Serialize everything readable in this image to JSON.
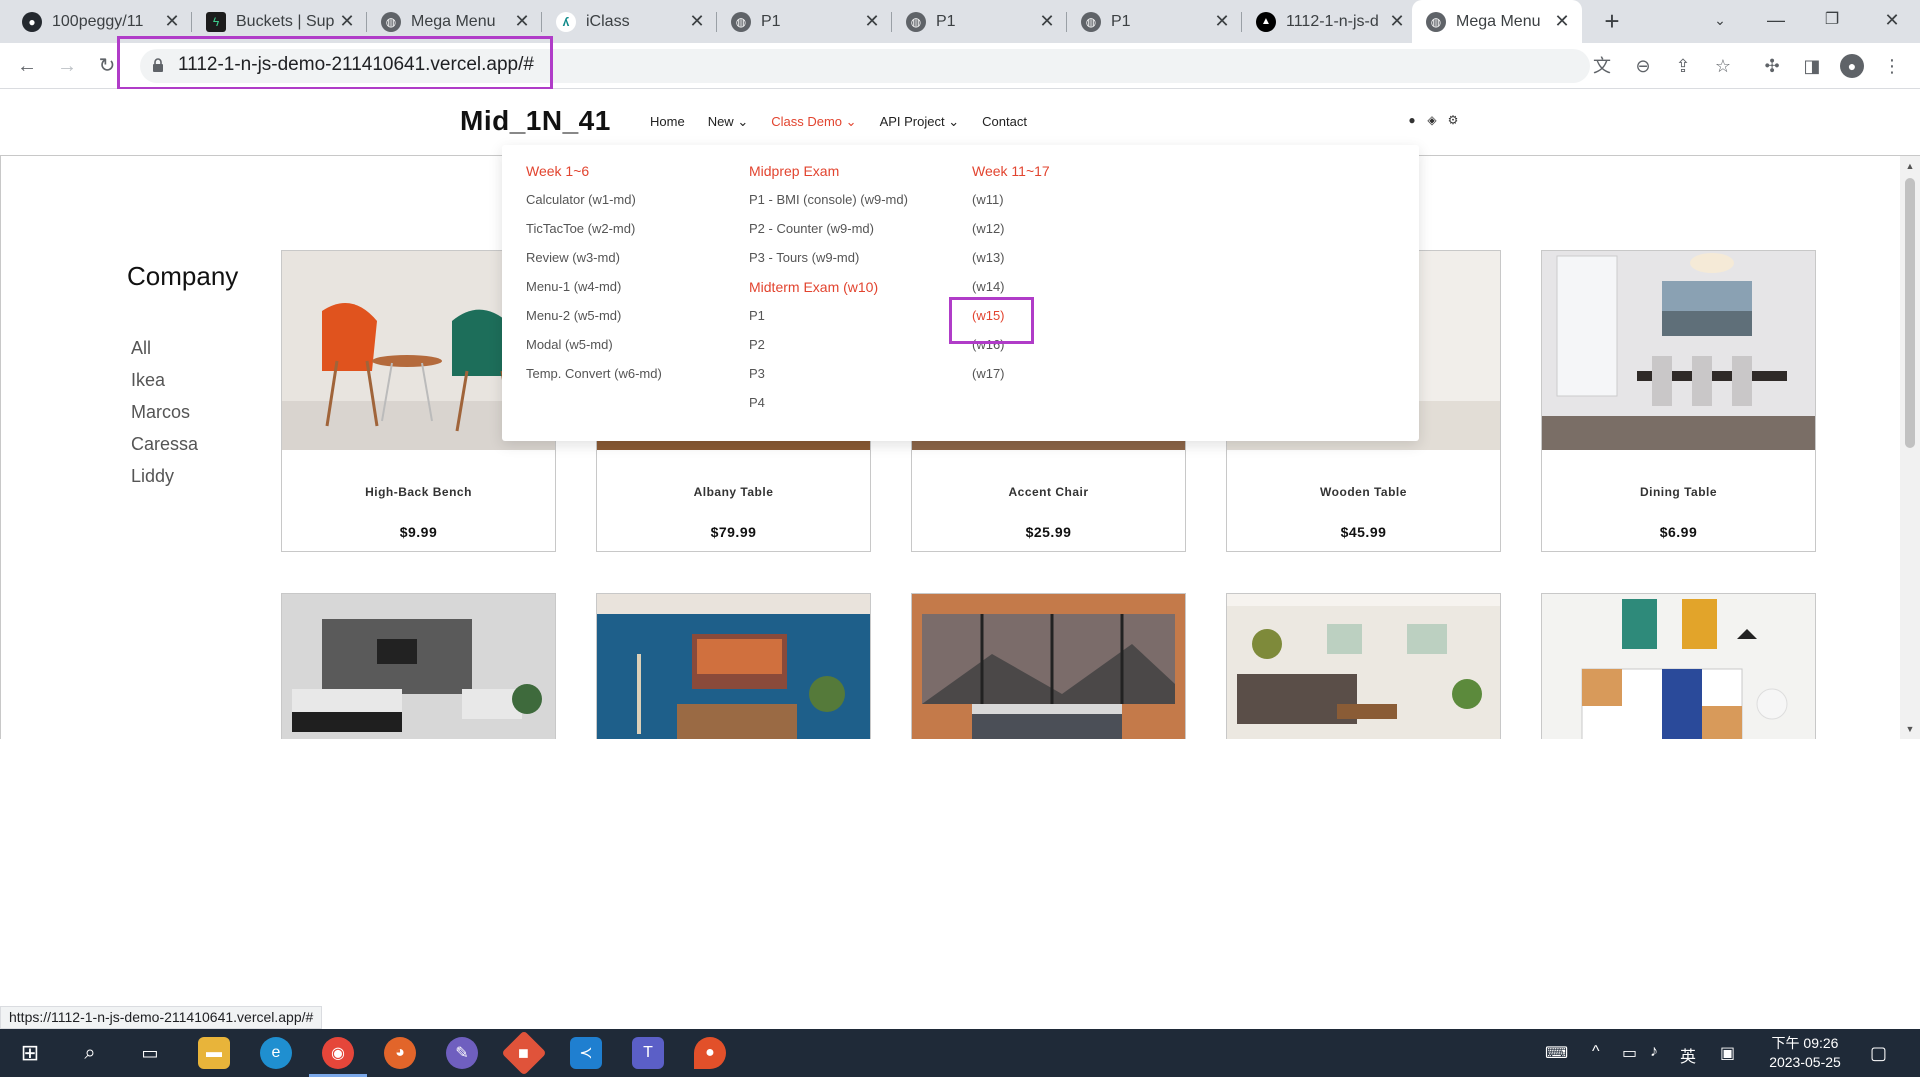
{
  "browser": {
    "tabs": [
      {
        "title": "100peggy/11",
        "icon": "github-icon",
        "active": false
      },
      {
        "title": "Buckets | Sup",
        "icon": "supabase-icon",
        "active": false
      },
      {
        "title": "Mega Menu",
        "icon": "globe-icon",
        "active": false
      },
      {
        "title": "iClass",
        "icon": "iclass-icon",
        "active": false
      },
      {
        "title": "P1",
        "icon": "globe-icon",
        "active": false
      },
      {
        "title": "P1",
        "icon": "globe-icon",
        "active": false
      },
      {
        "title": "P1",
        "icon": "globe-icon",
        "active": false
      },
      {
        "title": "1112-1-n-js-d",
        "icon": "vercel-icon",
        "active": false
      },
      {
        "title": "Mega Menu",
        "icon": "globe-icon",
        "active": true
      }
    ],
    "url": "1112-1-n-js-demo-211410641.vercel.app/#",
    "status_url": "https://1112-1-n-js-demo-211410641.vercel.app/#"
  },
  "site": {
    "logo": "Mid_1N_41",
    "nav": [
      "Home",
      "New",
      "Class Demo",
      "API Project",
      "Contact"
    ],
    "active_nav": "Class Demo"
  },
  "mega_menu": {
    "col1": {
      "heading": "Week 1~6",
      "links": [
        "Calculator (w1-md)",
        "TicTacToe (w2-md)",
        "Review (w3-md)",
        "Menu-1 (w4-md)",
        "Menu-2 (w5-md)",
        "Modal (w5-md)",
        "Temp. Convert (w6-md)"
      ]
    },
    "col2": {
      "heading": "Midprep Exam",
      "links": [
        "P1 - BMI (console) (w9-md)",
        "P2 - Counter (w9-md)",
        "P3 - Tours (w9-md)"
      ],
      "heading2": "Midterm Exam (w10)",
      "links2": [
        "P1",
        "P2",
        "P3",
        "P4"
      ]
    },
    "col3": {
      "heading": "Week 11~17",
      "links": [
        "(w11)",
        "(w12)",
        "(w13)",
        "(w14)",
        "(w15)",
        "(w16)",
        "(w17)"
      ],
      "highlighted": "(w15)"
    }
  },
  "sidebar": {
    "title": "Company",
    "items": [
      "All",
      "Ikea",
      "Marcos",
      "Caressa",
      "Liddy"
    ]
  },
  "products": [
    {
      "name": "High-Back Bench",
      "price": "$9.99"
    },
    {
      "name": "Albany Table",
      "price": "$79.99"
    },
    {
      "name": "Accent Chair",
      "price": "$25.99"
    },
    {
      "name": "Wooden Table",
      "price": "$45.99"
    },
    {
      "name": "Dining Table",
      "price": "$6.99"
    }
  ],
  "taskbar": {
    "time": "下午 09:26",
    "date": "2023-05-25",
    "ime": "英"
  },
  "colors": {
    "accent": "#e2442f",
    "highlight_box": "#b03cc8"
  }
}
